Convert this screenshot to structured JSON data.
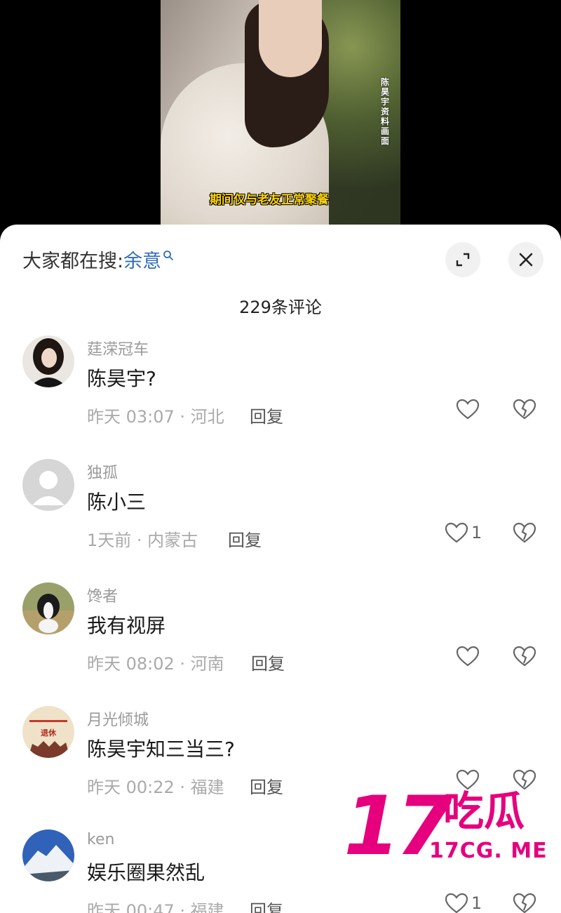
{
  "video": {
    "side_caption": "陈昊宇资料画面",
    "subtitle": "期间仅与老友正常聚餐"
  },
  "panel": {
    "search_prefix": "大家都在搜:",
    "search_term": "余意",
    "comment_count": "229条评论"
  },
  "comments": [
    {
      "username": "莛溁冠车",
      "text": "陈昊宇?",
      "time_location": "昨天 03:07 · 河北",
      "reply": "回复",
      "likes": ""
    },
    {
      "username": "独孤",
      "text": "陈小三",
      "time_location": "1天前 · 内蒙古",
      "reply": "回复",
      "likes": "1"
    },
    {
      "username": "馋者",
      "text": "我有视屏",
      "time_location": "昨天 08:02 · 河南",
      "reply": "回复",
      "likes": ""
    },
    {
      "username": "月光倾城",
      "text": "陈昊宇知三当三?",
      "time_location": "昨天 00:22 · 福建",
      "reply": "回复",
      "likes": "",
      "avatar_text": "退休"
    },
    {
      "username": "ken",
      "text": "娱乐圈果然乱",
      "time_location": "昨天 00:47 · 福建",
      "reply": "回复",
      "likes": "1"
    }
  ],
  "watermark": {
    "number": "17",
    "chinese": "吃瓜",
    "url": "17CG. ME"
  },
  "colors": {
    "accent_link": "#2f6db5",
    "watermark": "#e6007e",
    "subtitle": "#ffd400"
  }
}
